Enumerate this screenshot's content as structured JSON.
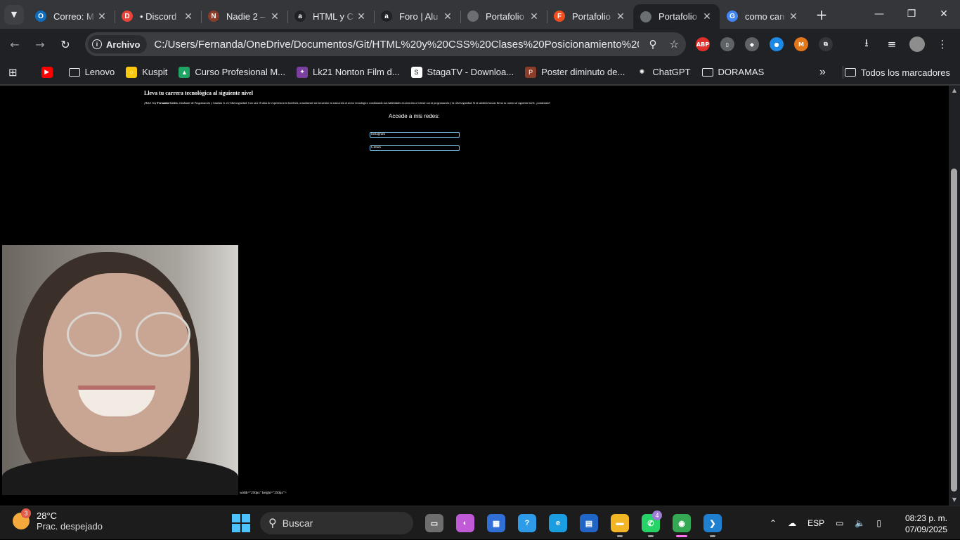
{
  "browser": {
    "tabs": [
      {
        "label": "Correo: M",
        "favicon": "outlook-icon",
        "color": "#0f6cbd",
        "glyph": "O"
      },
      {
        "label": "• Discord",
        "favicon": "discord-icon",
        "color": "#e8443a",
        "glyph": "D"
      },
      {
        "label": "Nadie 2 –",
        "favicon": "movie-icon",
        "color": "#8a3d2b",
        "glyph": "N"
      },
      {
        "label": "HTML y C",
        "favicon": "alura-icon",
        "color": "#202124",
        "glyph": "a"
      },
      {
        "label": "Foro | Alu",
        "favicon": "alura-icon",
        "color": "#202124",
        "glyph": "a"
      },
      {
        "label": "Portafolio",
        "favicon": "globe-icon",
        "color": "#6b6e73",
        "glyph": ""
      },
      {
        "label": "Portafolio",
        "favicon": "figma-icon",
        "color": "#f24e1e",
        "glyph": "F"
      },
      {
        "label": "Portafolio",
        "favicon": "globe-icon",
        "color": "#6b6e73",
        "glyph": "",
        "active": true
      },
      {
        "label": "como can",
        "favicon": "google-icon",
        "color": "#4285f4",
        "glyph": "G"
      }
    ],
    "tab_search_icon": "chevron-down-icon",
    "new_tab_icon": "plus-icon",
    "omnibox": {
      "chip_label": "Archivo",
      "url": "C:/Users/Fernanda/OneDrive/Documentos/Git/HTML%20y%20CSS%20Clases%20Posicionamiento%20y%20Fle..."
    },
    "extensions": [
      {
        "name": "adblock-plus-icon",
        "color": "#e0302b",
        "glyph": "ABP"
      },
      {
        "name": "mouse-icon",
        "color": "#5f6368",
        "glyph": "▯"
      },
      {
        "name": "shield-icon",
        "color": "#5f6368",
        "glyph": "◆"
      },
      {
        "name": "edge-extension-icon",
        "color": "#1e88e5",
        "glyph": "●"
      },
      {
        "name": "metamask-icon",
        "color": "#e2761b",
        "glyph": "M"
      },
      {
        "name": "puzzle-icon",
        "color": "#35363a",
        "glyph": "⧉"
      }
    ],
    "bookmarks": [
      {
        "label": "",
        "icon": "youtube-icon",
        "color": "#ff0000",
        "glyph": "▶"
      },
      {
        "label": "Lenovo",
        "icon": "folder-icon"
      },
      {
        "label": "Kuspit",
        "icon": "kuspit-icon",
        "color": "#f9c80e",
        "glyph": "○"
      },
      {
        "label": "Curso Profesional M...",
        "icon": "drive-icon",
        "color": "#1fa463",
        "glyph": "▲"
      },
      {
        "label": "Lk21 Nonton Film d...",
        "icon": "lk21-icon",
        "color": "#7b3fa0",
        "glyph": "✦"
      },
      {
        "label": "StagaTV - Downloa...",
        "icon": "stagatv-icon",
        "color": "#ffffff",
        "glyph": "S"
      },
      {
        "label": "Poster diminuto de...",
        "icon": "poster-icon",
        "color": "#8a3d2b",
        "glyph": "P"
      },
      {
        "label": "ChatGPT",
        "icon": "chatgpt-icon",
        "color": "#202124",
        "glyph": "✺"
      },
      {
        "label": "DORAMAS",
        "icon": "folder-icon"
      }
    ],
    "all_bookmarks_label": "Todos los marcadores"
  },
  "page": {
    "title": "Lleva tu carrera tecnológica al siguiente nivel",
    "intro_prefix": "¡Hola! Soy ",
    "intro_name": "Fernanda Cortes",
    "intro_suffix": ", estudiante de Programación y Analista Jr. en Ciberseguridad. Con casi 10 años de experiencia en hotelería, actualmente me encuentro en transición al sector tecnológico combinando mis habilidades en atención al cliente con la programación y la ciberseguridad. Si tú también buscas llevar tu carrera al siguiente nivel, ¡contáctame!",
    "social_heading": "Accede a mis redes:",
    "links": [
      "Instagram",
      "Github"
    ],
    "stray_text": "width=\"250px\" height=\"250px\">"
  },
  "taskbar": {
    "weather_badge": "3",
    "temperature": "28°C",
    "condition": "Prac. despejado",
    "search_placeholder": "Buscar",
    "apps": [
      {
        "name": "task-view-icon",
        "color": "#6e6e6e",
        "glyph": "▭"
      },
      {
        "name": "copilot-icon",
        "color": "#c05ad6",
        "glyph": "◐"
      },
      {
        "name": "store-icon",
        "color": "#2f6fd6",
        "glyph": "▦"
      },
      {
        "name": "help-icon",
        "color": "#2e9be8",
        "glyph": "?"
      },
      {
        "name": "edge-icon",
        "color": "#1b9de2",
        "glyph": "e"
      },
      {
        "name": "notes-app-icon",
        "color": "#2166c7",
        "glyph": "▤"
      },
      {
        "name": "file-explorer-icon",
        "color": "#f2b624",
        "glyph": "▬",
        "running": true
      },
      {
        "name": "whatsapp-icon",
        "color": "#25d366",
        "glyph": "✆",
        "badge": "4",
        "running": true
      },
      {
        "name": "chrome-icon",
        "color": "#34a853",
        "glyph": "◉",
        "active": true
      },
      {
        "name": "vscode-icon",
        "color": "#1f7fd1",
        "glyph": "❯",
        "running": true
      }
    ],
    "language": "ESP",
    "time": "08:23 p. m.",
    "date": "07/09/2025"
  }
}
